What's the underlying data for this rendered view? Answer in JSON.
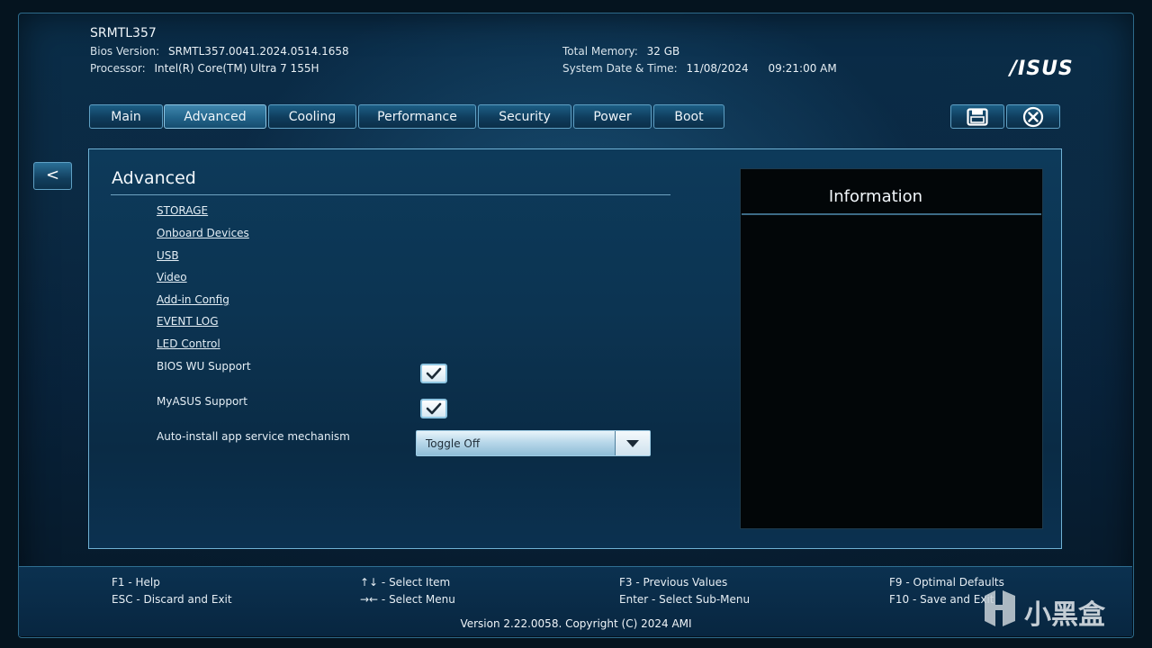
{
  "header": {
    "hostname": "SRMTL357",
    "bios_version_label": "Bios Version:",
    "bios_version": "SRMTL357.0041.2024.0514.1658",
    "processor_label": "Processor:",
    "processor": "Intel(R) Core(TM) Ultra 7 155H",
    "total_memory_label": "Total Memory:",
    "total_memory": "32 GB",
    "datetime_label": "System Date & Time:",
    "date": "11/08/2024",
    "time": "09:21:00 AM",
    "brand": "/ISUS"
  },
  "tabs": [
    {
      "label": "Main"
    },
    {
      "label": "Advanced",
      "active": true
    },
    {
      "label": "Cooling"
    },
    {
      "label": "Performance"
    },
    {
      "label": "Security"
    },
    {
      "label": "Power"
    },
    {
      "label": "Boot"
    }
  ],
  "toolbar": {
    "save_icon": "save-icon",
    "close_icon": "close-circle-icon",
    "back_label": "<"
  },
  "panel": {
    "title": "Advanced",
    "links": [
      {
        "label": "STORAGE"
      },
      {
        "label": "Onboard Devices"
      },
      {
        "label": "USB"
      },
      {
        "label": "Video"
      },
      {
        "label": "Add-in Config"
      },
      {
        "label": "EVENT LOG"
      },
      {
        "label": "LED Control"
      }
    ],
    "options": [
      {
        "label": "BIOS WU Support",
        "checked": true
      },
      {
        "label": "MyASUS Support",
        "checked": true
      }
    ],
    "auto_install": {
      "label": "Auto-install app service mechanism",
      "value": "Toggle Off"
    }
  },
  "info": {
    "title": "Information"
  },
  "footer": {
    "keys": [
      "F1 - Help",
      "ESC - Discard and Exit",
      "↑↓ - Select Item",
      "→← - Select Menu",
      "F3 - Previous Values",
      "Enter - Select Sub-Menu",
      "F9 - Optimal Defaults",
      "F10 - Save and Exit"
    ],
    "version": "Version 2.22.0058. Copyright (C) 2024 AMI",
    "watermark": "小黑盒"
  },
  "colors": {
    "accent_border": "#5fa0c4",
    "panel_bg": "#0c3452",
    "info_bg": "#020608"
  }
}
